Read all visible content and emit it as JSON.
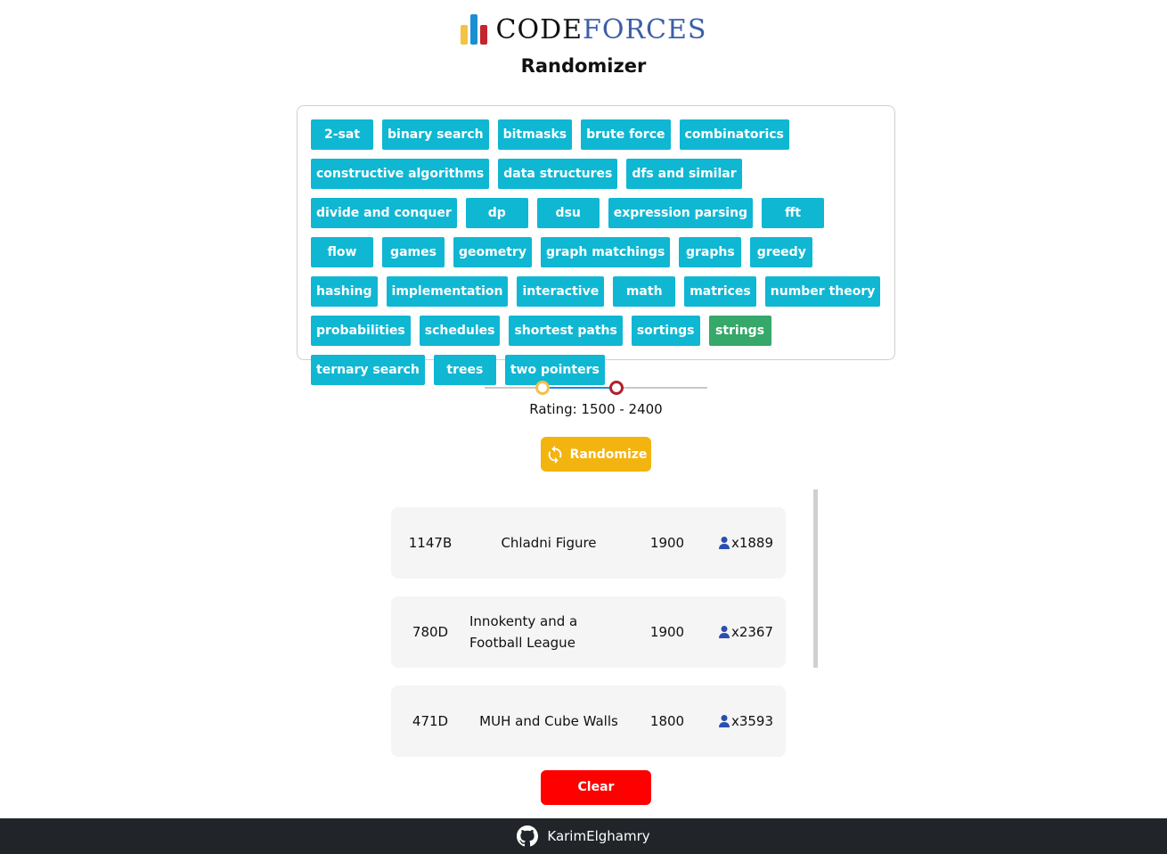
{
  "header": {
    "logo_code": "CODE",
    "logo_forces": "FORCES",
    "subtitle": "Randomizer"
  },
  "tags": [
    {
      "label": "2-sat",
      "selected": false
    },
    {
      "label": "binary search",
      "selected": false
    },
    {
      "label": "bitmasks",
      "selected": false
    },
    {
      "label": "brute force",
      "selected": false
    },
    {
      "label": "combinatorics",
      "selected": false
    },
    {
      "label": "constructive algorithms",
      "selected": false
    },
    {
      "label": "data structures",
      "selected": false
    },
    {
      "label": "dfs and similar",
      "selected": false
    },
    {
      "label": "divide and conquer",
      "selected": false
    },
    {
      "label": "dp",
      "selected": false
    },
    {
      "label": "dsu",
      "selected": false
    },
    {
      "label": "expression parsing",
      "selected": false
    },
    {
      "label": "fft",
      "selected": false
    },
    {
      "label": "flow",
      "selected": false
    },
    {
      "label": "games",
      "selected": false
    },
    {
      "label": "geometry",
      "selected": false
    },
    {
      "label": "graph matchings",
      "selected": false
    },
    {
      "label": "graphs",
      "selected": false
    },
    {
      "label": "greedy",
      "selected": false
    },
    {
      "label": "hashing",
      "selected": false
    },
    {
      "label": "implementation",
      "selected": false
    },
    {
      "label": "interactive",
      "selected": false
    },
    {
      "label": "math",
      "selected": false
    },
    {
      "label": "matrices",
      "selected": false
    },
    {
      "label": "number theory",
      "selected": false
    },
    {
      "label": "probabilities",
      "selected": false
    },
    {
      "label": "schedules",
      "selected": false
    },
    {
      "label": "shortest paths",
      "selected": false
    },
    {
      "label": "sortings",
      "selected": false
    },
    {
      "label": "strings",
      "selected": true
    },
    {
      "label": "ternary search",
      "selected": false
    },
    {
      "label": "trees",
      "selected": false
    },
    {
      "label": "two pointers",
      "selected": false
    }
  ],
  "rating": {
    "label": "Rating: 1500 - 2400",
    "min": 1500,
    "max": 2400,
    "range_min": 800,
    "range_max": 3500
  },
  "randomize_label": "Randomize",
  "problems": [
    {
      "id": "1147B",
      "name": "Chladni Figure",
      "rating": "1900",
      "solved": "x1889"
    },
    {
      "id": "780D",
      "name": "Innokenty and a Football League",
      "rating": "1900",
      "solved": "x2367"
    },
    {
      "id": "471D",
      "name": "MUH and Cube Walls",
      "rating": "1800",
      "solved": "x3593"
    }
  ],
  "clear_label": "Clear",
  "footer": {
    "username": "KarimElghamry"
  },
  "colors": {
    "tag": "#0fb7d3",
    "tag_selected": "#35a86a",
    "randomize": "#f3b40f",
    "clear": "#ff0000",
    "footer": "#212529"
  }
}
